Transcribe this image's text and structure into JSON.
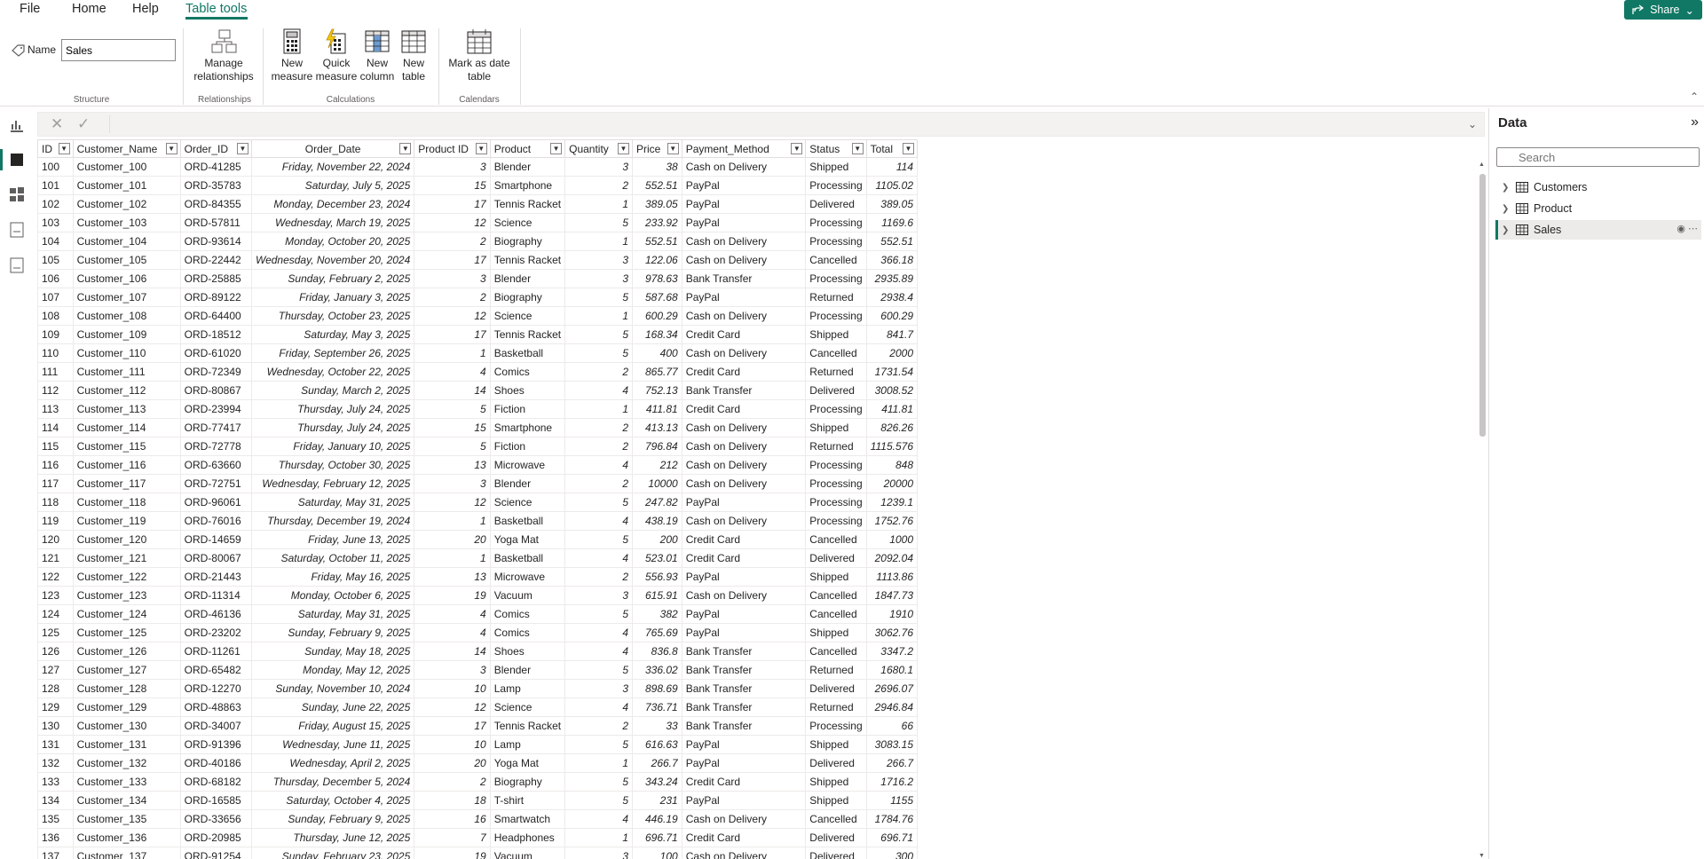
{
  "menu": {
    "file": "File",
    "home": "Home",
    "help": "Help",
    "table_tools": "Table tools",
    "share": "Share"
  },
  "ribbon": {
    "name_label": "Name",
    "name_value": "Sales",
    "structure_label": "Structure",
    "manage_relationships": "Manage relationships",
    "relationships_label": "Relationships",
    "new_measure": "New measure",
    "quick_measure": "Quick measure",
    "new_column": "New column",
    "new_table": "New table",
    "calculations_label": "Calculations",
    "mark_as_date_table": "Mark as date table",
    "calendars_label": "Calendars"
  },
  "table": {
    "columns": [
      "ID",
      "Customer_Name",
      "Order_ID",
      "Order_Date",
      "Product ID",
      "Product",
      "Quantity",
      "Price",
      "Payment_Method",
      "Status",
      "Total"
    ],
    "rows": [
      [
        "100",
        "Customer_100",
        "ORD-41285",
        "Friday, November 22, 2024",
        "3",
        "Blender",
        "3",
        "38",
        "Cash on Delivery",
        "Shipped",
        "114"
      ],
      [
        "101",
        "Customer_101",
        "ORD-35783",
        "Saturday, July 5, 2025",
        "15",
        "Smartphone",
        "2",
        "552.51",
        "PayPal",
        "Processing",
        "1105.02"
      ],
      [
        "102",
        "Customer_102",
        "ORD-84355",
        "Monday, December 23, 2024",
        "17",
        "Tennis Racket",
        "1",
        "389.05",
        "PayPal",
        "Delivered",
        "389.05"
      ],
      [
        "103",
        "Customer_103",
        "ORD-57811",
        "Wednesday, March 19, 2025",
        "12",
        "Science",
        "5",
        "233.92",
        "PayPal",
        "Processing",
        "1169.6"
      ],
      [
        "104",
        "Customer_104",
        "ORD-93614",
        "Monday, October 20, 2025",
        "2",
        "Biography",
        "1",
        "552.51",
        "Cash on Delivery",
        "Processing",
        "552.51"
      ],
      [
        "105",
        "Customer_105",
        "ORD-22442",
        "Wednesday, November 20, 2024",
        "17",
        "Tennis Racket",
        "3",
        "122.06",
        "Cash on Delivery",
        "Cancelled",
        "366.18"
      ],
      [
        "106",
        "Customer_106",
        "ORD-25885",
        "Sunday, February 2, 2025",
        "3",
        "Blender",
        "3",
        "978.63",
        "Bank Transfer",
        "Processing",
        "2935.89"
      ],
      [
        "107",
        "Customer_107",
        "ORD-89122",
        "Friday, January 3, 2025",
        "2",
        "Biography",
        "5",
        "587.68",
        "PayPal",
        "Returned",
        "2938.4"
      ],
      [
        "108",
        "Customer_108",
        "ORD-64400",
        "Thursday, October 23, 2025",
        "12",
        "Science",
        "1",
        "600.29",
        "Cash on Delivery",
        "Processing",
        "600.29"
      ],
      [
        "109",
        "Customer_109",
        "ORD-18512",
        "Saturday, May 3, 2025",
        "17",
        "Tennis Racket",
        "5",
        "168.34",
        "Credit Card",
        "Shipped",
        "841.7"
      ],
      [
        "110",
        "Customer_110",
        "ORD-61020",
        "Friday, September 26, 2025",
        "1",
        "Basketball",
        "5",
        "400",
        "Cash on Delivery",
        "Cancelled",
        "2000"
      ],
      [
        "111",
        "Customer_111",
        "ORD-72349",
        "Wednesday, October 22, 2025",
        "4",
        "Comics",
        "2",
        "865.77",
        "Credit Card",
        "Returned",
        "1731.54"
      ],
      [
        "112",
        "Customer_112",
        "ORD-80867",
        "Sunday, March 2, 2025",
        "14",
        "Shoes",
        "4",
        "752.13",
        "Bank Transfer",
        "Delivered",
        "3008.52"
      ],
      [
        "113",
        "Customer_113",
        "ORD-23994",
        "Thursday, July 24, 2025",
        "5",
        "Fiction",
        "1",
        "411.81",
        "Credit Card",
        "Processing",
        "411.81"
      ],
      [
        "114",
        "Customer_114",
        "ORD-77417",
        "Thursday, July 24, 2025",
        "15",
        "Smartphone",
        "2",
        "413.13",
        "Cash on Delivery",
        "Shipped",
        "826.26"
      ],
      [
        "115",
        "Customer_115",
        "ORD-72778",
        "Friday, January 10, 2025",
        "5",
        "Fiction",
        "2",
        "796.84",
        "Cash on Delivery",
        "Returned",
        "1115.576"
      ],
      [
        "116",
        "Customer_116",
        "ORD-63660",
        "Thursday, October 30, 2025",
        "13",
        "Microwave",
        "4",
        "212",
        "Cash on Delivery",
        "Processing",
        "848"
      ],
      [
        "117",
        "Customer_117",
        "ORD-72751",
        "Wednesday, February 12, 2025",
        "3",
        "Blender",
        "2",
        "10000",
        "Cash on Delivery",
        "Processing",
        "20000"
      ],
      [
        "118",
        "Customer_118",
        "ORD-96061",
        "Saturday, May 31, 2025",
        "12",
        "Science",
        "5",
        "247.82",
        "PayPal",
        "Processing",
        "1239.1"
      ],
      [
        "119",
        "Customer_119",
        "ORD-76016",
        "Thursday, December 19, 2024",
        "1",
        "Basketball",
        "4",
        "438.19",
        "Cash on Delivery",
        "Processing",
        "1752.76"
      ],
      [
        "120",
        "Customer_120",
        "ORD-14659",
        "Friday, June 13, 2025",
        "20",
        "Yoga Mat",
        "5",
        "200",
        "Credit Card",
        "Cancelled",
        "1000"
      ],
      [
        "121",
        "Customer_121",
        "ORD-80067",
        "Saturday, October 11, 2025",
        "1",
        "Basketball",
        "4",
        "523.01",
        "Credit Card",
        "Delivered",
        "2092.04"
      ],
      [
        "122",
        "Customer_122",
        "ORD-21443",
        "Friday, May 16, 2025",
        "13",
        "Microwave",
        "2",
        "556.93",
        "PayPal",
        "Shipped",
        "1113.86"
      ],
      [
        "123",
        "Customer_123",
        "ORD-11314",
        "Monday, October 6, 2025",
        "19",
        "Vacuum",
        "3",
        "615.91",
        "Cash on Delivery",
        "Cancelled",
        "1847.73"
      ],
      [
        "124",
        "Customer_124",
        "ORD-46136",
        "Saturday, May 31, 2025",
        "4",
        "Comics",
        "5",
        "382",
        "PayPal",
        "Cancelled",
        "1910"
      ],
      [
        "125",
        "Customer_125",
        "ORD-23202",
        "Sunday, February 9, 2025",
        "4",
        "Comics",
        "4",
        "765.69",
        "PayPal",
        "Shipped",
        "3062.76"
      ],
      [
        "126",
        "Customer_126",
        "ORD-11261",
        "Sunday, May 18, 2025",
        "14",
        "Shoes",
        "4",
        "836.8",
        "Bank Transfer",
        "Cancelled",
        "3347.2"
      ],
      [
        "127",
        "Customer_127",
        "ORD-65482",
        "Monday, May 12, 2025",
        "3",
        "Blender",
        "5",
        "336.02",
        "Bank Transfer",
        "Returned",
        "1680.1"
      ],
      [
        "128",
        "Customer_128",
        "ORD-12270",
        "Sunday, November 10, 2024",
        "10",
        "Lamp",
        "3",
        "898.69",
        "Bank Transfer",
        "Delivered",
        "2696.07"
      ],
      [
        "129",
        "Customer_129",
        "ORD-48863",
        "Sunday, June 22, 2025",
        "12",
        "Science",
        "4",
        "736.71",
        "Bank Transfer",
        "Returned",
        "2946.84"
      ],
      [
        "130",
        "Customer_130",
        "ORD-34007",
        "Friday, August 15, 2025",
        "17",
        "Tennis Racket",
        "2",
        "33",
        "Bank Transfer",
        "Processing",
        "66"
      ],
      [
        "131",
        "Customer_131",
        "ORD-91396",
        "Wednesday, June 11, 2025",
        "10",
        "Lamp",
        "5",
        "616.63",
        "PayPal",
        "Shipped",
        "3083.15"
      ],
      [
        "132",
        "Customer_132",
        "ORD-40186",
        "Wednesday, April 2, 2025",
        "20",
        "Yoga Mat",
        "1",
        "266.7",
        "PayPal",
        "Delivered",
        "266.7"
      ],
      [
        "133",
        "Customer_133",
        "ORD-68182",
        "Thursday, December 5, 2024",
        "2",
        "Biography",
        "5",
        "343.24",
        "Credit Card",
        "Shipped",
        "1716.2"
      ],
      [
        "134",
        "Customer_134",
        "ORD-16585",
        "Saturday, October 4, 2025",
        "18",
        "T-shirt",
        "5",
        "231",
        "PayPal",
        "Shipped",
        "1155"
      ],
      [
        "135",
        "Customer_135",
        "ORD-33656",
        "Sunday, February 9, 2025",
        "16",
        "Smartwatch",
        "4",
        "446.19",
        "Cash on Delivery",
        "Cancelled",
        "1784.76"
      ],
      [
        "136",
        "Customer_136",
        "ORD-20985",
        "Thursday, June 12, 2025",
        "7",
        "Headphones",
        "1",
        "696.71",
        "Credit Card",
        "Delivered",
        "696.71"
      ],
      [
        "137",
        "Customer_137",
        "ORD-91254",
        "Sunday, February 23, 2025",
        "19",
        "Vacuum",
        "3",
        "100",
        "Cash on Delivery",
        "Delivered",
        "300"
      ]
    ]
  },
  "data_pane": {
    "title": "Data",
    "search_placeholder": "Search",
    "tables": [
      "Customers",
      "Product",
      "Sales"
    ],
    "selected": "Sales"
  },
  "colors": {
    "accent": "#117865",
    "border": "#e1dfdd"
  }
}
